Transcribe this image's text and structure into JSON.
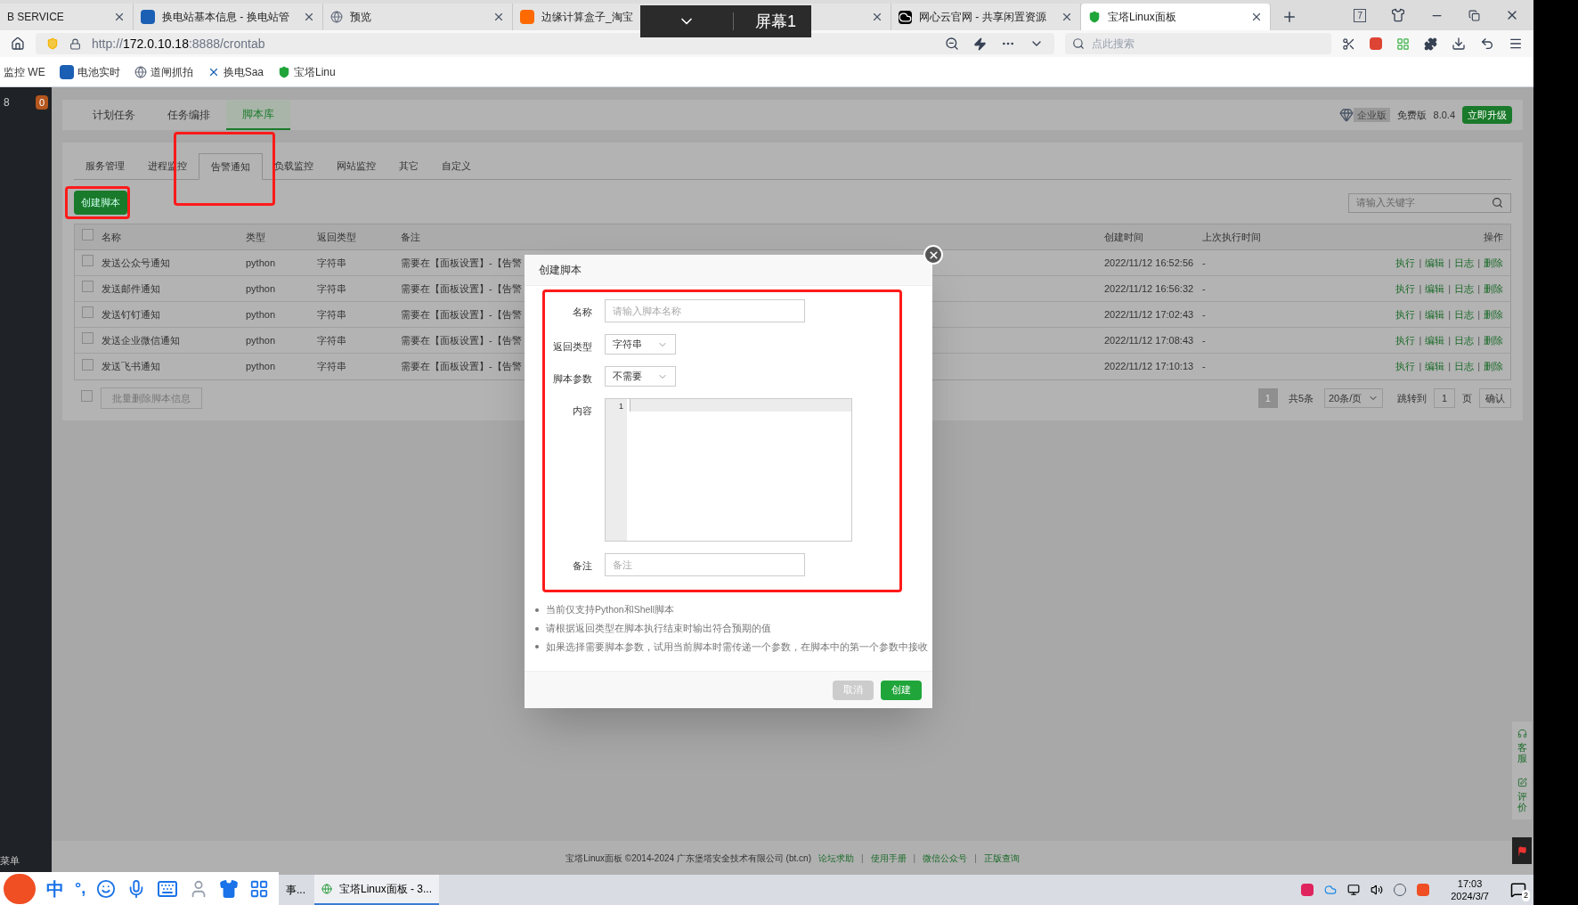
{
  "browser": {
    "tabs": [
      {
        "title": "B SERVICE",
        "selected": false,
        "kind": "none"
      },
      {
        "title": "换电站基本信息 - 换电站管",
        "selected": false,
        "kind": "g"
      },
      {
        "title": "预览",
        "selected": false,
        "kind": "globe"
      },
      {
        "title": "边缘计算盒子_淘宝",
        "selected": false,
        "kind": "taobao"
      },
      {
        "title": "网心云官网 - 共享闲置资源",
        "selected": false,
        "kind": "cloud"
      },
      {
        "title": "宝塔Linux面板",
        "selected": true,
        "kind": "shield"
      }
    ],
    "tab_count": "7",
    "address": {
      "url_prefix": "http://",
      "url_host": "172.0.10.18",
      "url_rest": ":8888/crontab"
    },
    "search": {
      "placeholder": "点此搜索"
    },
    "bookmarks": [
      {
        "title": "监控 WE",
        "kind": "none"
      },
      {
        "title": "电池实时",
        "kind": "g"
      },
      {
        "title": "道闸抓拍",
        "kind": "globe"
      },
      {
        "title": "换电Saa",
        "kind": "x"
      },
      {
        "title": "宝塔Linu",
        "kind": "shield"
      }
    ]
  },
  "screen_share": {
    "label": "屏幕1"
  },
  "sidebar": {
    "number": "8",
    "badge": "0",
    "menu": "菜单"
  },
  "top_tabs": [
    {
      "label": "计划任务",
      "selected": false
    },
    {
      "label": "任务编排",
      "selected": false
    },
    {
      "label": "脚本库",
      "selected": true
    }
  ],
  "edition": {
    "enterprise": "企业版",
    "free": "免费版",
    "version": "8.0.4",
    "upgrade": "立即升级"
  },
  "sub_tabs": [
    {
      "label": "服务管理",
      "selected": false,
      "highlighted": false
    },
    {
      "label": "进程监控",
      "selected": false,
      "highlighted": false
    },
    {
      "label": "告警通知",
      "selected": true,
      "highlighted": true
    },
    {
      "label": "负载监控",
      "selected": false,
      "highlighted": false
    },
    {
      "label": "网站监控",
      "selected": false,
      "highlighted": false
    },
    {
      "label": "其它",
      "selected": false,
      "highlighted": false
    },
    {
      "label": "自定义",
      "selected": false,
      "highlighted": false
    }
  ],
  "create_button": {
    "label": "创建脚本",
    "highlighted": true
  },
  "search": {
    "placeholder": "请输入关键字"
  },
  "table": {
    "all_checked": false,
    "columns": [
      "名称",
      "类型",
      "返回类型",
      "备注",
      "创建时间",
      "上次执行时间",
      "操作"
    ],
    "separator": "|",
    "rows": [
      {
        "checked": false,
        "name": "发送公众号通知",
        "type": "python",
        "return_type": "字符串",
        "note": "需要在【面板设置】-【告警",
        "created": "2022/11/12 16:52:56",
        "last_run": "-",
        "actions": [
          "执行",
          "编辑",
          "日志",
          "删除"
        ]
      },
      {
        "checked": false,
        "name": "发送邮件通知",
        "type": "python",
        "return_type": "字符串",
        "note": "需要在【面板设置】-【告警",
        "created": "2022/11/12 16:56:32",
        "last_run": "-",
        "actions": [
          "执行",
          "编辑",
          "日志",
          "删除"
        ]
      },
      {
        "checked": false,
        "name": "发送钉钉通知",
        "type": "python",
        "return_type": "字符串",
        "note": "需要在【面板设置】-【告警",
        "created": "2022/11/12 17:02:43",
        "last_run": "-",
        "actions": [
          "执行",
          "编辑",
          "日志",
          "删除"
        ]
      },
      {
        "checked": false,
        "name": "发送企业微信通知",
        "type": "python",
        "return_type": "字符串",
        "note": "需要在【面板设置】-【告警",
        "created": "2022/11/12 17:08:43",
        "last_run": "-",
        "actions": [
          "执行",
          "编辑",
          "日志",
          "删除"
        ]
      },
      {
        "checked": false,
        "name": "发送飞书通知",
        "type": "python",
        "return_type": "字符串",
        "note": "需要在【面板设置】-【告警",
        "created": "2022/11/12 17:10:13",
        "last_run": "-",
        "actions": [
          "执行",
          "编辑",
          "日志",
          "删除"
        ]
      }
    ]
  },
  "batch": {
    "checked": false,
    "button": "批量删除脚本信息"
  },
  "pagination": {
    "pages": [
      {
        "label": "1",
        "selected": true
      }
    ],
    "total": "共5条",
    "per_page": "20条/页",
    "goto": "跳转到",
    "page_value": "1",
    "page_unit": "页",
    "confirm": "确认"
  },
  "modal": {
    "title": "创建脚本",
    "highlighted": true,
    "fields": [
      {
        "kind": "input",
        "label": "名称",
        "placeholder": "请输入脚本名称"
      },
      {
        "kind": "select",
        "label": "返回类型",
        "value": "字符串"
      },
      {
        "kind": "select",
        "label": "脚本参数",
        "value": "不需要"
      },
      {
        "kind": "code",
        "label": "内容",
        "line_numbers": [
          "1"
        ]
      },
      {
        "kind": "input",
        "label": "备注",
        "placeholder": "备注"
      }
    ],
    "notes": [
      "当前仅支持Python和Shell脚本",
      "请根据返回类型在脚本执行结束时输出符合预期的值",
      "如果选择需要脚本参数，试用当前脚本时需传递一个参数，在脚本中的第一个参数中接收"
    ],
    "cancel": "取消",
    "create": "创建"
  },
  "float_tabs": [
    {
      "label": "客服",
      "kind": "headset"
    },
    {
      "label": "评价",
      "kind": "edit"
    }
  ],
  "footer": {
    "copyright": "宝塔Linux面板 ©2014-2024 广东堡塔安全技术有限公司 (bt.cn)",
    "separator": "|",
    "links": [
      "论坛求助",
      "使用手册",
      "微信公众号",
      "正版查询"
    ]
  },
  "ime": {
    "lang": "中",
    "punct": "°,"
  },
  "taskbar": {
    "apps": [
      {
        "title": "事...",
        "active": false
      },
      {
        "title": "宝塔Linux面板 - 3...",
        "active": true
      }
    ],
    "time": "17:03",
    "date": "2024/3/7",
    "notifications": "2"
  }
}
